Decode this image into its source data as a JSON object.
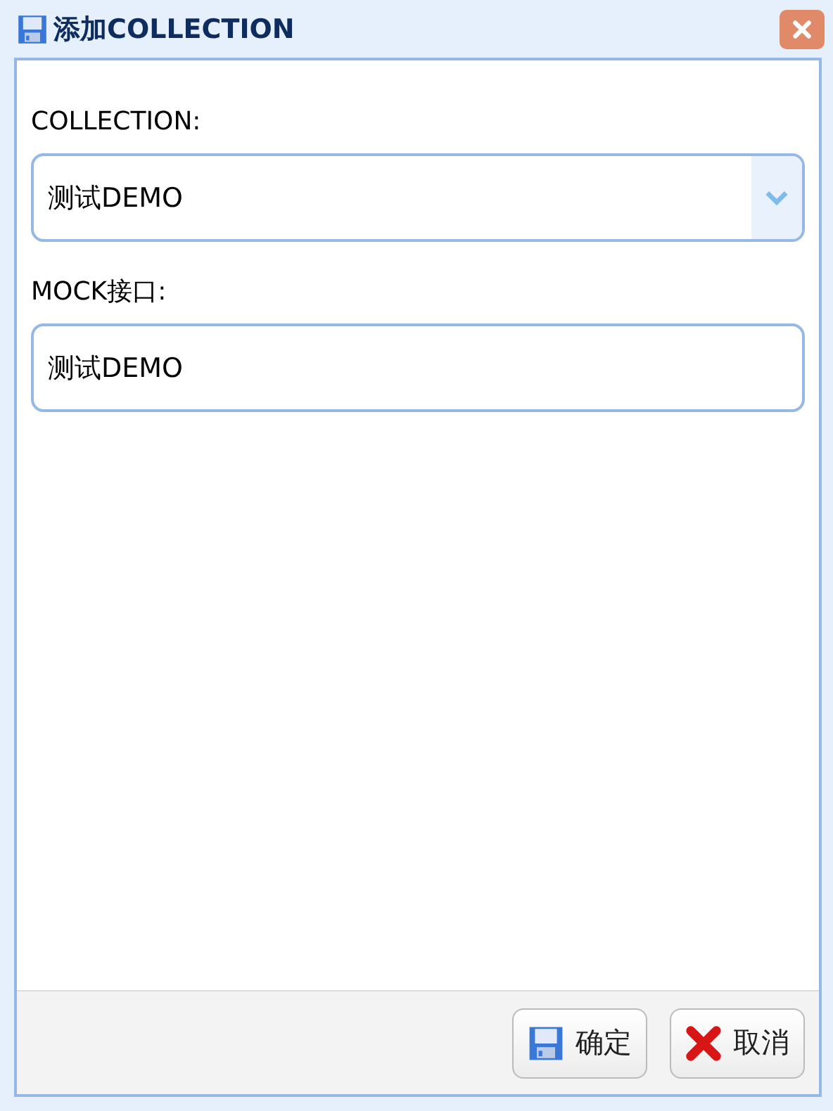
{
  "window": {
    "title": "添加COLLECTION"
  },
  "fields": [
    {
      "kind": "select",
      "label": "COLLECTION:",
      "value": "测试DEMO"
    },
    {
      "kind": "text",
      "label": "MOCK接口:",
      "value": "测试DEMO"
    }
  ],
  "buttons": [
    {
      "kind": "save",
      "label": "确定"
    },
    {
      "kind": "cancel",
      "label": "取消"
    }
  ]
}
